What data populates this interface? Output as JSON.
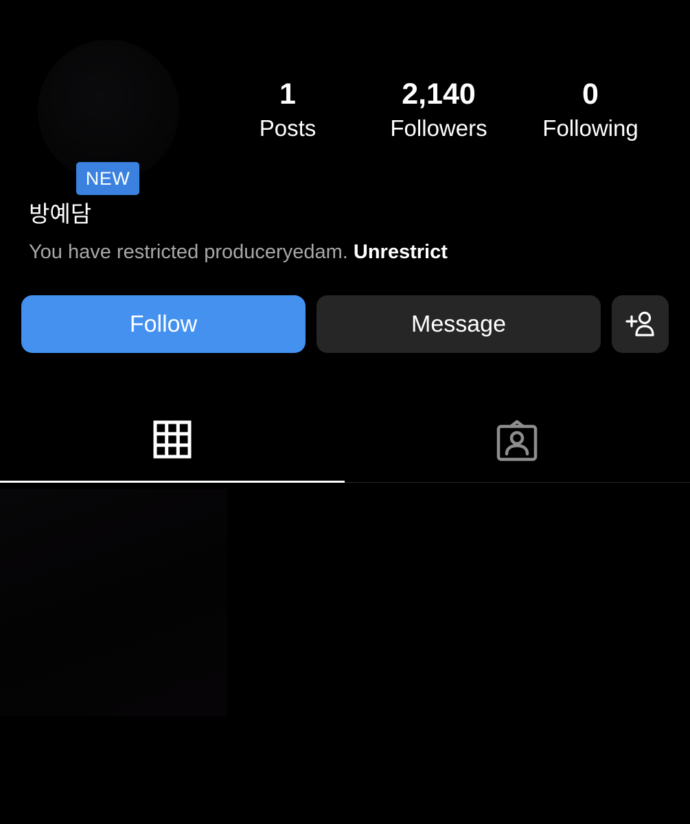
{
  "profile": {
    "new_badge": "NEW",
    "display_name": "방예담",
    "restrict_text": "You have restricted producerye­dam.",
    "unrestrict_label": "Unrestrict"
  },
  "stats": {
    "posts": {
      "value": "1",
      "label": "Posts"
    },
    "followers": {
      "value": "2,140",
      "label": "Followers"
    },
    "following": {
      "value": "0",
      "label": "Following"
    }
  },
  "actions": {
    "follow_label": "Follow",
    "message_label": "Message",
    "suggest_icon": "add-person-icon"
  },
  "tabs": [
    {
      "icon": "grid-icon",
      "selected": true
    },
    {
      "icon": "tagged-person-icon",
      "selected": false
    }
  ],
  "colors": {
    "follow_button": "#4491f0",
    "new_badge": "#3b82e0",
    "secondary_button": "#262626",
    "muted_text": "#a8a8a8"
  }
}
